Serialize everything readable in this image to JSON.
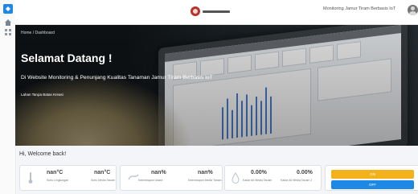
{
  "topbar": {
    "user_label": "Monitoring Jamur Tiram Berbasis IoT"
  },
  "hero": {
    "breadcrumb": "Home / Dashboard",
    "title": "Selamat Datang !",
    "subtitle": "Di Website Monitoring & Penunjang Kualitas Tanaman Jamur Tiram Berbasis IoT",
    "tagline": "Lahan Tanpa Batas Kreasi"
  },
  "welcome": "Hi, Welcome back!",
  "metrics": [
    {
      "value": "nan°C",
      "label": "Suhu Lingkungan"
    },
    {
      "value": "nan°C",
      "label": "Suhu Media Tanam"
    },
    {
      "value": "nan%",
      "label": "Kelembapan Udara"
    },
    {
      "value": "nan%",
      "label": "Kelembapan Media Tanam"
    },
    {
      "value": "0.00%",
      "label": "Kadar Air Media Tanam"
    },
    {
      "value": "0.00%",
      "label": "Kadar Air Media Tanam 2"
    }
  ],
  "controls": {
    "on_label": "ON",
    "off_label": "OFF"
  },
  "colors": {
    "accent": "#1e88e5",
    "warning": "#f3b21b"
  },
  "icons": {
    "rail": [
      "home-icon",
      "grid-icon"
    ],
    "metric": [
      "thermometer-icon",
      "humidity-icon",
      "water-drop-icon"
    ]
  }
}
